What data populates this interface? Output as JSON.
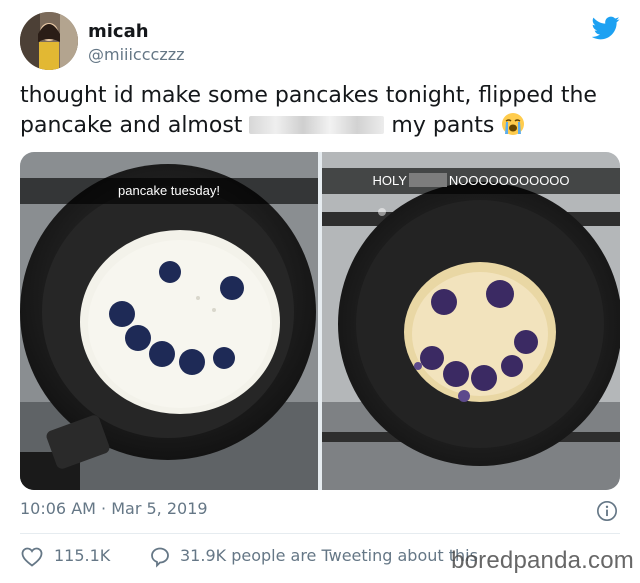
{
  "author": {
    "display_name": "micah",
    "handle": "@miiiccczzz",
    "avatar_icon": "profile-photo",
    "logo_icon": "twitter-bird-icon",
    "brand_color": "#1da1f2"
  },
  "tweet": {
    "text_line1": "thought id make some pancakes tonight, flipped the",
    "text_line2_before": "pancake and almost",
    "text_line2_after": "my pants",
    "emoji": "loudly-crying-face",
    "timestamp": "10:06 AM · Mar 5, 2019"
  },
  "media": [
    {
      "caption": "pancake tuesday!",
      "description_icon": "pan-with-blueberry-smiley-pancake"
    },
    {
      "caption_before": "HOLY",
      "caption_after": "NOOOOOOOOOOO",
      "description_icon": "pan-with-flipped-burnt-pancake"
    }
  ],
  "stats": {
    "likes": "115.1K",
    "retweet_text": "31.9K people are Tweeting about this"
  },
  "watermark": "boredpanda.com"
}
